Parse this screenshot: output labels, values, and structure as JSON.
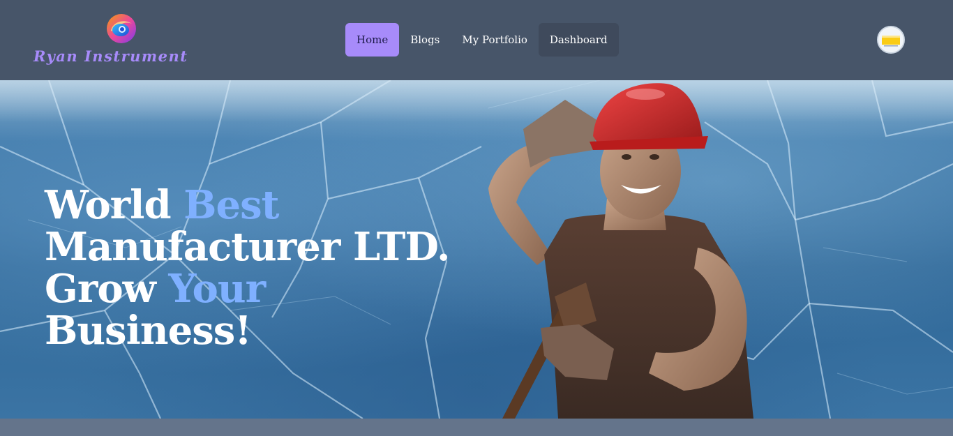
{
  "brand": {
    "name": "Ryan Instrument",
    "logo_icon": "orb-logo-icon"
  },
  "nav": {
    "items": [
      {
        "label": "Home",
        "active": true
      },
      {
        "label": "Blogs",
        "active": false
      },
      {
        "label": "My Portfolio",
        "active": false
      },
      {
        "label": "Dashboard",
        "active": false
      }
    ]
  },
  "user": {
    "avatar_icon": "user-avatar-icon"
  },
  "hero": {
    "line1_a": "World ",
    "line1_b": "Best",
    "line2_a": "Manufacturer ",
    "line2_b": "LTD.",
    "line3_a": "Grow ",
    "line3_b": "Your",
    "line4_a": "Business!",
    "image": "construction-worker-image"
  },
  "colors": {
    "navbar": "#475569",
    "accent": "#a78bfa",
    "highlight_text": "#7fb0ff",
    "page_bg": "#64748b"
  }
}
